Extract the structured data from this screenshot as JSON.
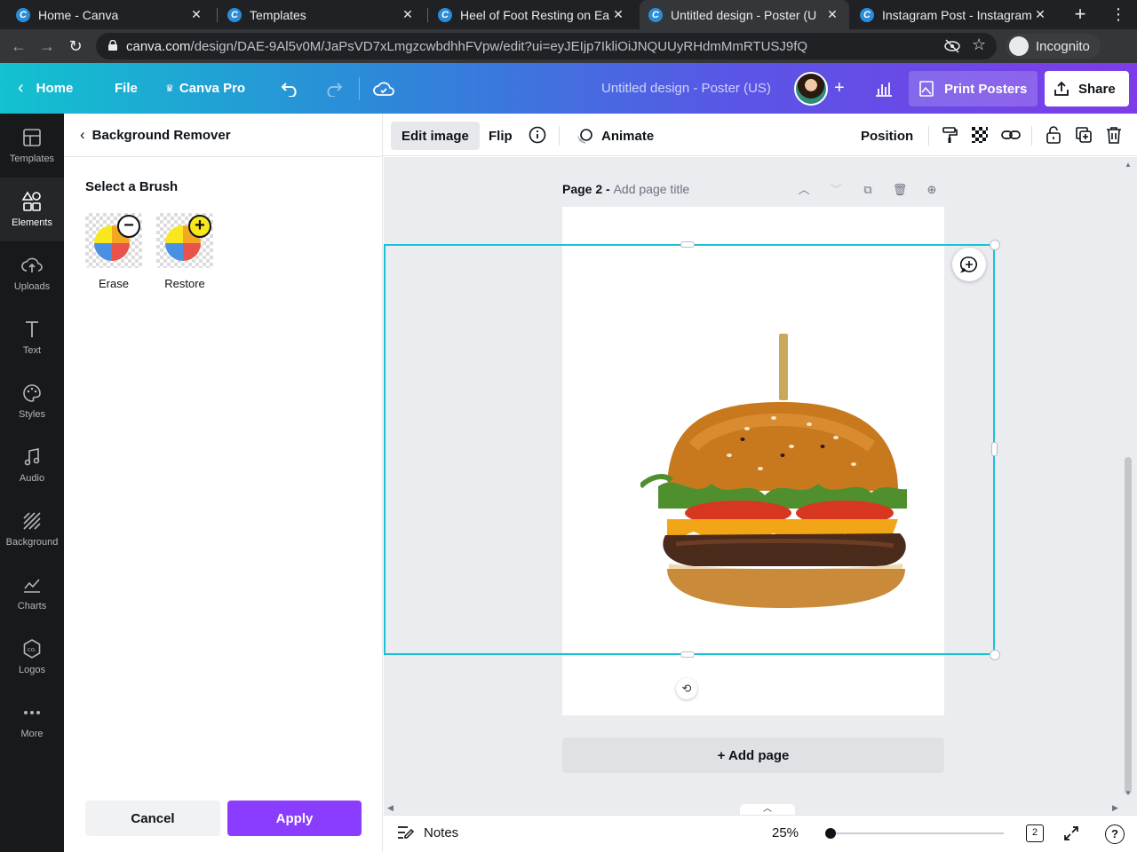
{
  "browser": {
    "tabs": [
      {
        "title": "Home - Canva"
      },
      {
        "title": "Templates"
      },
      {
        "title": "Heel of Foot Resting on Ea"
      },
      {
        "title": "Untitled design - Poster (U"
      },
      {
        "title": "Instagram Post - Instagram"
      }
    ],
    "active_tab_index": 3,
    "url_host": "canva.com",
    "url_path": "/design/DAE-9Al5v0M/JaPsVD7xLmgzcwbdhhFVpw/edit?ui=eyJEIjp7IkliOiJNQUUyRHdmMmRTUSJ9fQ",
    "incognito_label": "Incognito"
  },
  "header": {
    "home_label": "Home",
    "file_label": "File",
    "pro_label": "Canva Pro",
    "doc_title": "Untitled design - Poster (US)",
    "print_label": "Print Posters",
    "share_label": "Share"
  },
  "rail": {
    "items": [
      {
        "label": "Templates",
        "icon": "templates-icon"
      },
      {
        "label": "Elements",
        "icon": "elements-icon"
      },
      {
        "label": "Uploads",
        "icon": "upload-icon"
      },
      {
        "label": "Text",
        "icon": "text-icon"
      },
      {
        "label": "Styles",
        "icon": "palette-icon"
      },
      {
        "label": "Audio",
        "icon": "music-note-icon"
      },
      {
        "label": "Background",
        "icon": "background-icon"
      },
      {
        "label": "Charts",
        "icon": "chart-icon"
      },
      {
        "label": "Logos",
        "icon": "logo-icon"
      },
      {
        "label": "More",
        "icon": "more-dots-icon"
      }
    ],
    "active": "Elements"
  },
  "panel": {
    "back_label": "Background Remover",
    "section_title": "Select a Brush",
    "brushes": [
      {
        "label": "Erase",
        "badge": "−"
      },
      {
        "label": "Restore",
        "badge": "+"
      }
    ],
    "cancel_label": "Cancel",
    "apply_label": "Apply"
  },
  "context_toolbar": {
    "edit_image_label": "Edit image",
    "flip_label": "Flip",
    "animate_label": "Animate",
    "position_label": "Position"
  },
  "canvas": {
    "page_label": "Page 2 - ",
    "page_title_placeholder": "Add page title",
    "add_page_label": "+ Add page"
  },
  "footer": {
    "notes_label": "Notes",
    "zoom_label": "25%",
    "page_count": "2"
  },
  "colors": {
    "accent_purple": "#8b3dff",
    "selection_cyan": "#18c3d6",
    "rail_bg": "#18191b"
  }
}
